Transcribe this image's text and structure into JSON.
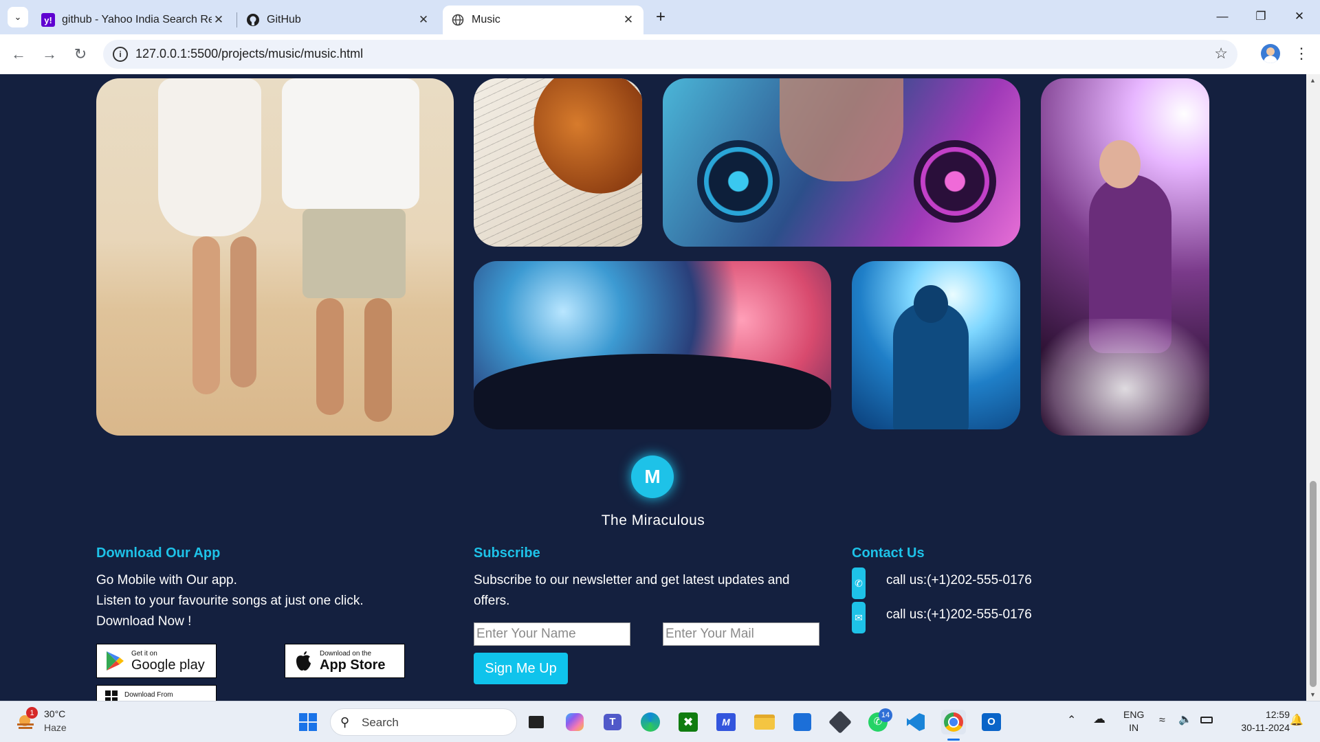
{
  "browser": {
    "tabs": [
      {
        "title": "github - Yahoo India Search Re",
        "favicon": "yahoo-icon",
        "active": false
      },
      {
        "title": "GitHub",
        "favicon": "github-icon",
        "active": false
      },
      {
        "title": "Music",
        "favicon": "globe-icon",
        "active": true
      }
    ],
    "url": "127.0.0.1:5500/projects/music/music.html"
  },
  "page": {
    "brand": {
      "logo_letter": "M",
      "name": "The Miraculous"
    },
    "download": {
      "title": "Download Our App",
      "lines": [
        "Go Mobile with Our app.",
        "Listen to your favourite songs at just one click.",
        "Download Now !"
      ],
      "google_small": "Get it on",
      "google_big": "Google play",
      "apple_small": "Download on the",
      "apple_big": "App Store",
      "windows_small": "Download From"
    },
    "subscribe": {
      "title": "Subscribe",
      "text_line1": "Subscribe to our newsletter and get latest updates and",
      "text_line2": "offers.",
      "name_placeholder": "Enter Your Name",
      "mail_placeholder": "Enter Your Mail",
      "button": "Sign Me Up"
    },
    "contact": {
      "title": "Contact Us",
      "items": [
        "call us:(+1)202-555-0176",
        "call us:(+1)202-555-0176"
      ]
    },
    "accent_color": "#1ec2e8",
    "background_color": "#14203f"
  },
  "taskbar": {
    "weather": {
      "badge": "1",
      "temp": "30°C",
      "condition": "Haze"
    },
    "search_label": "Search",
    "whatsapp_badge": "14",
    "language": {
      "line1": "ENG",
      "line2": "IN"
    },
    "time": "12:59",
    "date": "30-11-2024"
  }
}
